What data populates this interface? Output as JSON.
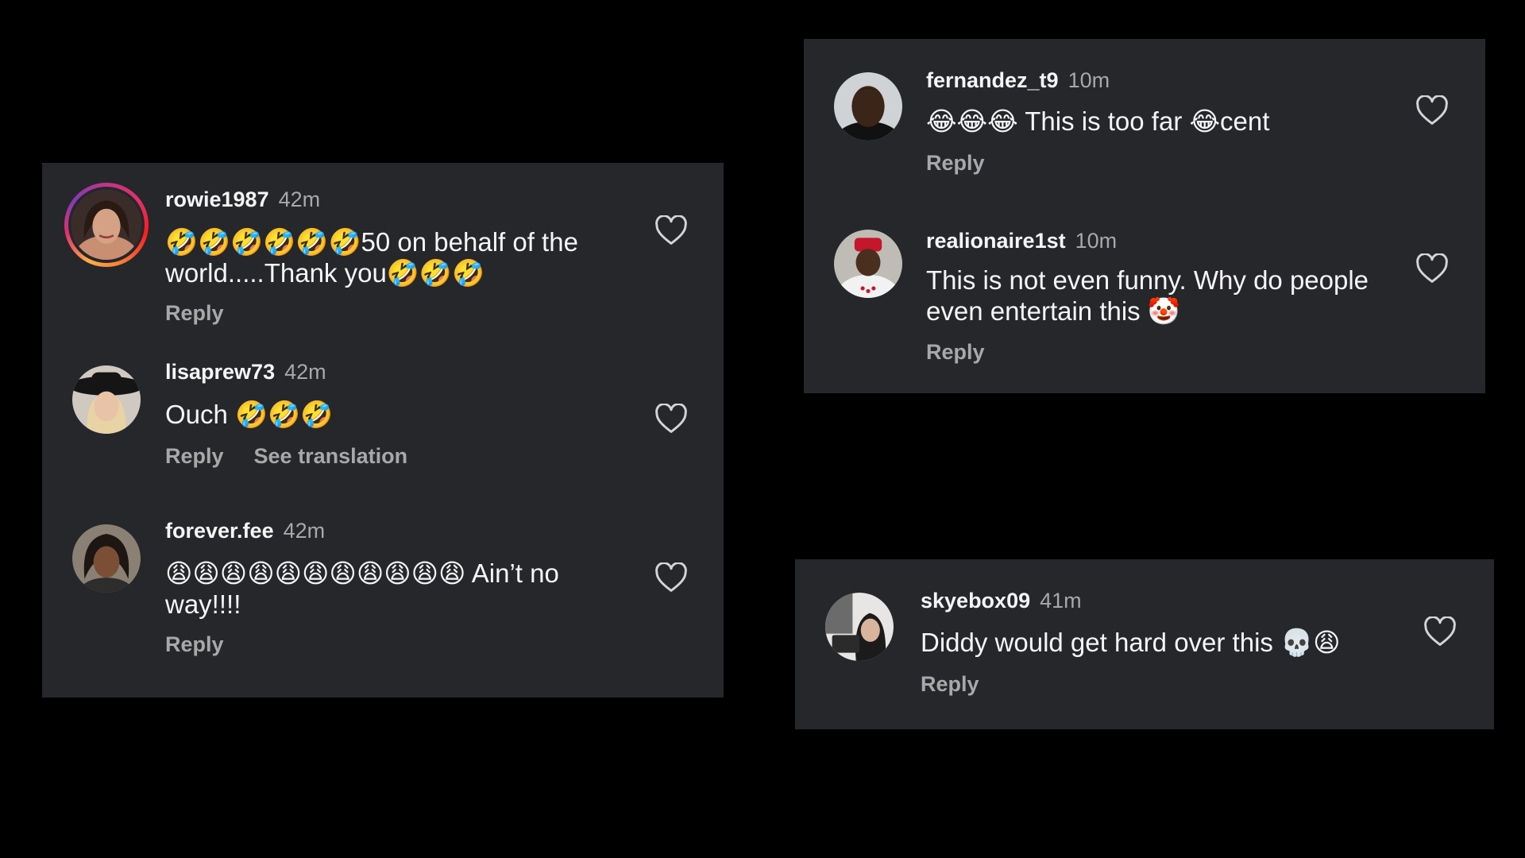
{
  "left_panel": {
    "comments": [
      {
        "username": "rowie1987",
        "time": "42m",
        "text": "🤣🤣🤣🤣🤣🤣50 on behalf of the world.....Thank you🤣🤣🤣",
        "reply_label": "Reply"
      },
      {
        "username": "lisaprew73",
        "time": "42m",
        "text": "Ouch 🤣🤣🤣",
        "reply_label": "Reply",
        "translation_label": "See translation"
      },
      {
        "username": "forever.fee",
        "time": "42m",
        "text": "😩😩😩😩😩😩😩😩😩😩😩 Ain’t no way!!!!",
        "reply_label": "Reply"
      }
    ]
  },
  "top_right_panel": {
    "comments": [
      {
        "username": "fernandez_t9",
        "time": "10m",
        "text": "😂😂😂 This is too far 😂cent",
        "reply_label": "Reply"
      },
      {
        "username": "realionaire1st",
        "time": "10m",
        "text": "This is not even funny. Why do people even entertain this 🤡",
        "reply_label": "Reply"
      }
    ]
  },
  "bottom_right_panel": {
    "comments": [
      {
        "username": "skyebox09",
        "time": "41m",
        "text": "Diddy would get hard over this 💀😩",
        "reply_label": "Reply"
      }
    ]
  },
  "colors": {
    "background": "#000000",
    "panel": "#25272b",
    "primary_text": "#f5f5f5",
    "secondary_text": "#a8a8a8"
  },
  "icons": {
    "like": "heart-outline-icon"
  }
}
